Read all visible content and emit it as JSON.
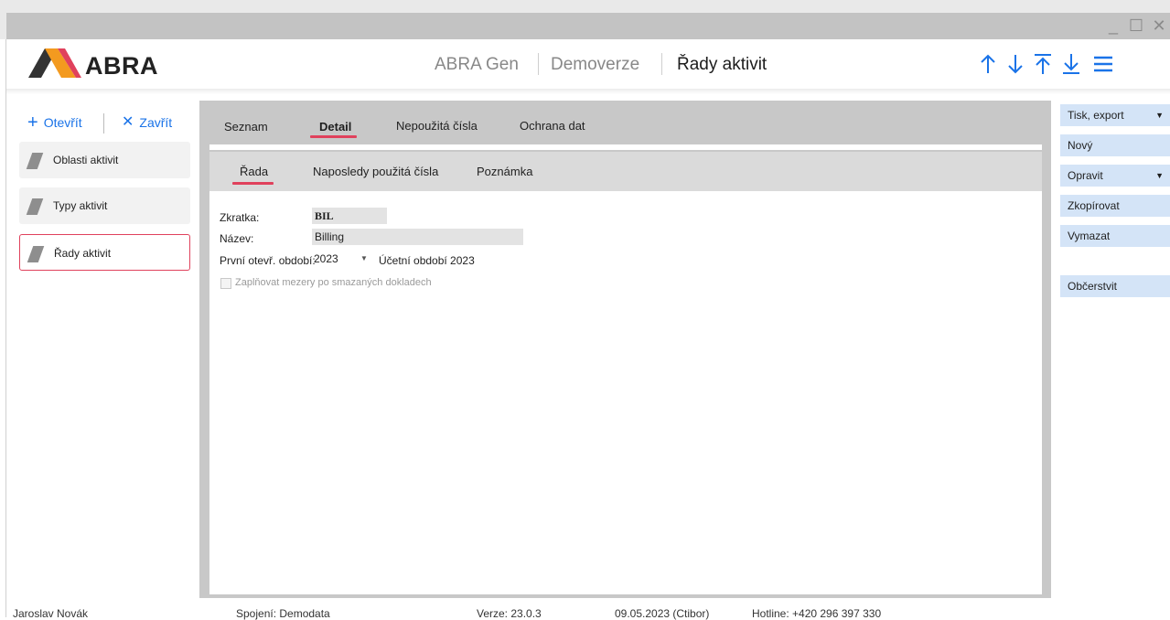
{
  "window": {
    "minimize_glyph": "_",
    "maximize_glyph": "☐",
    "close_glyph": "✕"
  },
  "header": {
    "logo": "ABRA",
    "breadcrumbs": [
      "ABRA Gen",
      "Demoverze",
      "Řady aktivit"
    ],
    "icons": [
      "arrow-up-icon",
      "arrow-down-icon",
      "arrow-to-top-icon",
      "arrow-to-bottom-icon",
      "menu-icon"
    ]
  },
  "sidebar": {
    "open_label": "Otevřít",
    "close_label": "Zavřít",
    "items": [
      {
        "label": "Oblasti aktivit"
      },
      {
        "label": "Typy aktivit"
      },
      {
        "label": "Řady aktivit",
        "selected": true
      }
    ]
  },
  "main_tabs": [
    {
      "label": "Seznam"
    },
    {
      "label": "Detail",
      "active": true
    },
    {
      "label": "Nepoužitá čísla"
    },
    {
      "label": "Ochrana dat"
    }
  ],
  "sub_tabs": [
    {
      "label": "Řada",
      "active": true
    },
    {
      "label": "Naposledy použitá čísla"
    },
    {
      "label": "Poznámka"
    }
  ],
  "form": {
    "zkratka_label": "Zkratka:",
    "zkratka_value": "BIL",
    "nazev_label": "Název:",
    "nazev_value": "Billing",
    "period_label": "První otevř. období:",
    "period_value": "2023",
    "period_text": "Účetní období 2023",
    "fill_gaps_label": "Zaplňovat mezery po smazaných dokladech",
    "fill_gaps_checked": false
  },
  "actions": [
    {
      "label": "Tisk, export",
      "dropdown": true
    },
    {
      "label": "Nový"
    },
    {
      "label": "Opravit",
      "dropdown": true
    },
    {
      "label": "Zkopírovat"
    },
    {
      "label": "Vymazat"
    },
    {
      "label": "Občerstvit"
    }
  ],
  "status": {
    "user": "Jaroslav Novák",
    "connection": "Spojení: Demodata",
    "version": "Verze: 23.0.3",
    "date": "09.05.2023 (Ctibor)",
    "hotline": "Hotline: +420 296 397 330"
  },
  "colors": {
    "accent": "#1a73e8",
    "selection": "#e0415c",
    "action_button": "#d4e4f7",
    "logo_orange": "#f39a1f",
    "logo_gray": "#333333"
  }
}
